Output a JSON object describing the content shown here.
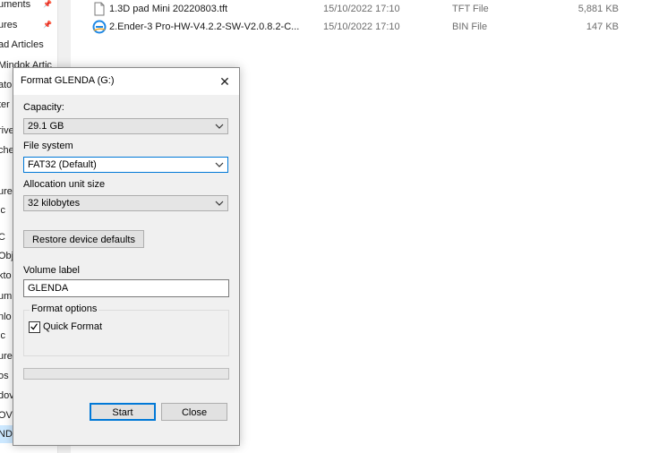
{
  "nav": {
    "items": [
      {
        "label": "uments",
        "pinned": true
      },
      {
        "label": "ures",
        "pinned": true
      },
      {
        "label": "ad Articles",
        "pinned": false
      },
      {
        "label": "Mindok Artic",
        "pinned": false
      },
      {
        "label": "ato",
        "pinned": false
      },
      {
        "label": "ter",
        "pinned": false
      },
      {
        "label": "rive",
        "pinned": false
      },
      {
        "label": "che",
        "pinned": false
      },
      {
        "label": "ure",
        "pinned": false
      },
      {
        "label": "ic",
        "pinned": false
      },
      {
        "label": "C",
        "pinned": false
      },
      {
        "label": "Obj",
        "pinned": false
      },
      {
        "label": "kto",
        "pinned": false
      },
      {
        "label": "um",
        "pinned": false
      },
      {
        "label": "nlo",
        "pinned": false
      },
      {
        "label": "ic",
        "pinned": false
      },
      {
        "label": "ure",
        "pinned": false
      },
      {
        "label": "os",
        "pinned": false
      },
      {
        "label": "dov",
        "pinned": false
      },
      {
        "label": "OV",
        "pinned": false
      },
      {
        "label": "ND",
        "pinned": false,
        "selected": true
      }
    ]
  },
  "files": [
    {
      "name": "1.3D pad Mini 20220803.tft",
      "date": "15/10/2022 17:10",
      "type": "TFT File",
      "size": "5,881 KB",
      "icon": "document-icon"
    },
    {
      "name": "2.Ender-3 Pro-HW-V4.2.2-SW-V2.0.8.2-C...",
      "date": "15/10/2022 17:10",
      "type": "BIN File",
      "size": "147 KB",
      "icon": "edge-icon"
    }
  ],
  "dialog": {
    "title": "Format GLENDA (G:)",
    "capacity_label": "Capacity:",
    "capacity_value": "29.1 GB",
    "filesystem_label": "File system",
    "filesystem_value": "FAT32 (Default)",
    "allocation_label": "Allocation unit size",
    "allocation_value": "32 kilobytes",
    "restore_button": "Restore device defaults",
    "volume_label_label": "Volume label",
    "volume_label_value": "GLENDA",
    "format_options_label": "Format options",
    "quick_format_label": "Quick Format",
    "quick_format_checked": true,
    "progress": 0,
    "start_button": "Start",
    "close_button": "Close"
  },
  "colors": {
    "accent": "#0078d7",
    "selection": "#cce8ff",
    "dialog_bg": "#f0f0f0"
  }
}
